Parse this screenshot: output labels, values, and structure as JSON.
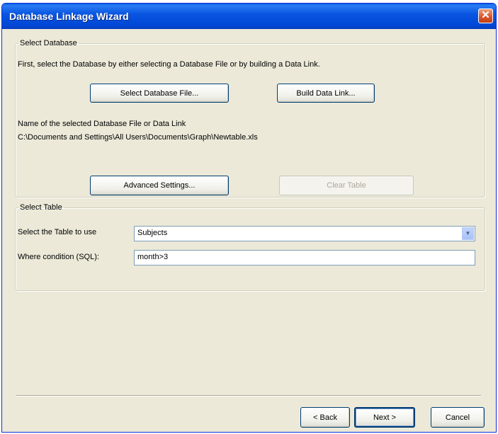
{
  "window": {
    "title": "Database Linkage Wizard",
    "close_icon": "✕"
  },
  "select_database": {
    "legend": "Select Database",
    "instructions": "First, select the Database by either selecting a Database File or by building a Data Link.",
    "select_file_button": "Select Database File...",
    "build_link_button": "Build Data Link...",
    "name_label": "Name of the selected Database File or Data Link",
    "path": "C:\\Documents and Settings\\All Users\\Documents\\Graph\\Newtable.xls",
    "advanced_button": "Advanced Settings...",
    "clear_table_button": "Clear Table"
  },
  "select_table": {
    "legend": "Select Table",
    "table_label": "Select the Table to use",
    "table_value": "Subjects",
    "dropdown_icon": "▼",
    "where_label": "Where condition (SQL):",
    "where_value": "month>3"
  },
  "footer": {
    "back_button": "< Back",
    "next_button": "Next >",
    "cancel_button": "Cancel"
  },
  "colors": {
    "titlebar": "#0a56e2",
    "dialog_bg": "#ece9d8",
    "close": "#d9532b"
  }
}
